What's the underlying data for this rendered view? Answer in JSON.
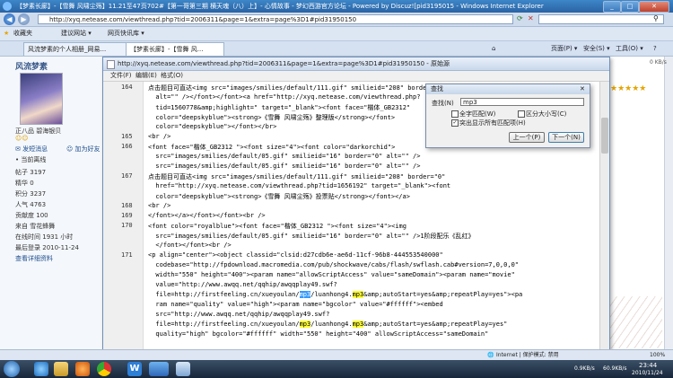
{
  "ie": {
    "title": "【梦素长廊】-【雪舞 风啸尘殇】11.21至47页702#【第一哥第三期 横天魂（八）上】- 心情故事 - 梦幻西游官方论坛 - Powered by Discuz![pid3195015 - Windows Internet Explorer",
    "address": "http://xyq.netease.com/viewthread.php?tid=2006311&page=1&extra=page%3D1#pid31950150",
    "favorites_label": "收藏夹",
    "fav_items": [
      "建议网站 ▾",
      "网页快讯库 ▾"
    ],
    "tabs": [
      "风流梦素的个人相册_网易...",
      "【梦素长廊】-【雪舞 风..."
    ],
    "commands": [
      "页面(P) ▾",
      "安全(S) ▾",
      "工具(O) ▾",
      "?"
    ],
    "status_left": "Internet | 保护模式: 禁用",
    "status_zoom": "100%",
    "speed": "0 KB/s"
  },
  "forum": {
    "username": "风流梦素",
    "rank": "正八品 碧海银贝",
    "actions": [
      "发短消息",
      "加为好友"
    ],
    "online": "当前离线",
    "stats": [
      {
        "k": "帖子",
        "v": "3197"
      },
      {
        "k": "精华",
        "v": "0"
      },
      {
        "k": "积分",
        "v": "3237"
      },
      {
        "k": "人气",
        "v": "4763"
      },
      {
        "k": "贡献度",
        "v": "100"
      },
      {
        "k": "来自",
        "v": "雪花蜂舞"
      },
      {
        "k": "在线时间",
        "v": "1931 小时"
      },
      {
        "k": "最后登录",
        "v": "2010-11-24"
      }
    ],
    "detail_link": "查看详细资料"
  },
  "source": {
    "title": "http://xyq.netease.com/viewthread.php?tid=2006311&page=1&extra=page%3D1#pid31950150 - 原始源",
    "menu": [
      "文件(F)",
      "编辑(E)",
      "格式(O)"
    ],
    "lines": [
      {
        "n": "164",
        "t": "点击题目可直达<img src=\"images/smilies/default/111.gif\" smilieid=\"208\" border=\"0\""
      },
      {
        "n": "",
        "t": "  alt=\"\" /></font></font><a href=\"http://xyq.netease.com/viewthread.php?"
      },
      {
        "n": "",
        "t": "  tid=1560778&amp;highlight=\" target=\"_blank\"><font face=\"楷体_GB2312\""
      },
      {
        "n": "",
        "t": "  color=\"deepskyblue\"><strong>《雪舞 风啸尘殇》整理版</strong></font>"
      },
      {
        "n": "",
        "t": "  color=\"deepskyblue\"></font></br>"
      },
      {
        "n": "165",
        "t": "<br />"
      },
      {
        "n": "166",
        "t": "<font face=\"楷体_GB2312 \"><font size=\"4\"><font color=\"darkorchid\">"
      },
      {
        "n": "",
        "t": "  src=\"images/smilies/default/05.gif\" smilieid=\"16\" border=\"0\" alt=\"\" />"
      },
      {
        "n": "",
        "t": "  src=\"images/smilies/default/05.gif\" smilieid=\"16\" border=\"0\" alt=\"\" />"
      },
      {
        "n": "167",
        "t": "点击题目可直达<img src=\"images/smilies/default/111.gif\" smilieid=\"208\" border=\"0\""
      },
      {
        "n": "",
        "t": "  href=\"http://xyq.netease.com/viewthread.php?tid=1656192\" target=\"_blank\"><font"
      },
      {
        "n": "",
        "t": "  color=\"deepskyblue\"><strong>《雪舞 风啸尘殇》投票贴</strong></font></a>"
      },
      {
        "n": "168",
        "t": "<br />"
      },
      {
        "n": "169",
        "t": "</font></a></font></font><br />"
      },
      {
        "n": "170",
        "t": "<font color=\"royalblue\"><font face=\"楷体_GB2312 \"><font size=\"4\"><img"
      },
      {
        "n": "",
        "t": "  src=\"images/smilies/default/05.gif\" smilieid=\"16\" border=\"0\" alt=\"\" />1阶段配乐《乱红》"
      },
      {
        "n": "",
        "t": "  </font></font><br />"
      },
      {
        "n": "171",
        "t": "<p align=\"center\"><object classid=\"clsid:d27cdb6e-ae6d-11cf-96b8-444553540000\""
      },
      {
        "n": "",
        "t": "  codebase=\"http://fpdownload.macromedia.com/pub/shockwave/cabs/flash/swflash.cab#version=7,0,0,0\""
      },
      {
        "n": "",
        "t": "  width=\"550\" height=\"400\"><param name=\"allowScriptAccess\" value=\"sameDomain\"><param name=\"movie\""
      },
      {
        "n": "",
        "t": "  value=\"http://www.awqq.net/qqhip/awqqplay49.swf?"
      },
      {
        "n": "",
        "t": "  file=http://firstfeeling.cn/xueyoulan/",
        "sel": "mp3",
        "t2": "/luanhong4.",
        "yel": "mp3",
        "t3": "&amp;autoStart=yes&amp;repeatPlay=yes\"><pa"
      },
      {
        "n": "",
        "t": "  ram name=\"quality\" value=\"high\"><param name=\"bgcolor\" value=\"#ffffff\"><embed"
      },
      {
        "n": "",
        "t": "  src=\"http://www.awqq.net/qqhip/awqqplay49.swf?"
      },
      {
        "n": "",
        "t": "  file=http://firstfeeling.cn/xueyoulan/",
        "sel": "",
        "yel2": "mp3",
        "t2": "/luanhong4.",
        "yel": "mp3",
        "t3": "&amp;autoStart=yes&amp;repeatPlay=yes\""
      },
      {
        "n": "",
        "t": "  quality=\"high\" bgcolor=\"#ffffff\" width=\"550\" height=\"400\" allowScriptAccess=\"sameDomain\""
      }
    ]
  },
  "find": {
    "title": "查找",
    "label": "查找(N)",
    "value": "mp3",
    "opt_whole": "全字匹配(W)",
    "opt_case": "区分大小写(C)",
    "opt_highlight": "突出显示所有匹配项(H)",
    "prev": "上一个(P)",
    "next": "下一个(N)"
  },
  "taskbar": {
    "time": "23:44",
    "date": "2010/11/24",
    "speed_up": "0.9KB/s",
    "speed_down": "60.9KB/s"
  }
}
